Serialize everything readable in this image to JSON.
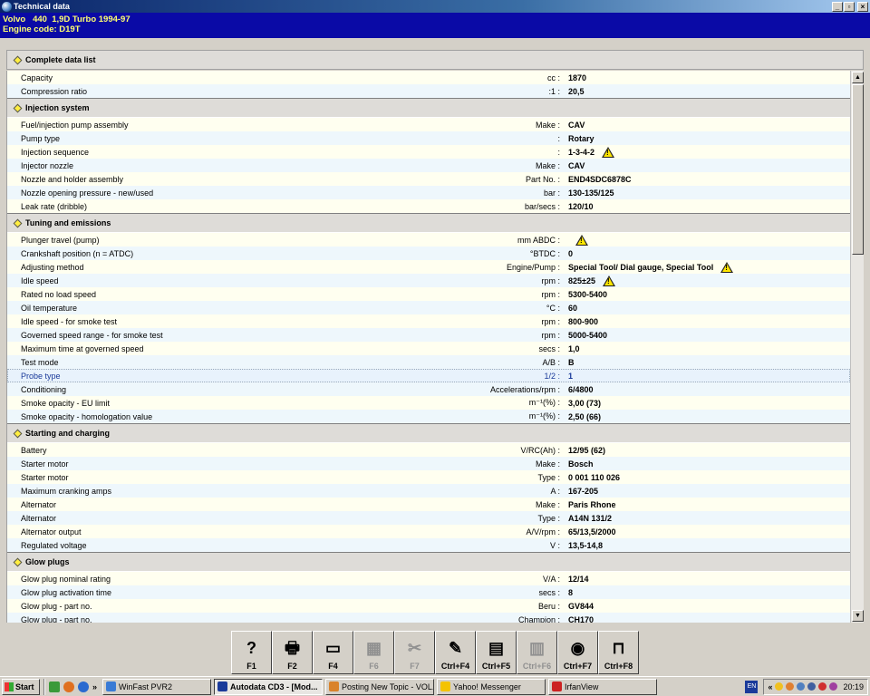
{
  "window": {
    "title": "Technical data",
    "buttons": [
      "_",
      "▫",
      "×"
    ]
  },
  "header": {
    "line1": "Volvo   440  1,9D Turbo 1994-97",
    "line2": "Engine code: D19T"
  },
  "main_title": "Complete data list",
  "general": [
    {
      "label": "Capacity",
      "unit": "cc :",
      "value": "1870",
      "warn": false
    },
    {
      "label": "Compression ratio",
      "unit": ":1 :",
      "value": "20,5",
      "warn": false
    }
  ],
  "sections": [
    {
      "title": "Injection system",
      "rows": [
        {
          "label": "Fuel/injection pump assembly",
          "unit": "Make :",
          "value": "CAV",
          "warn": false
        },
        {
          "label": "Pump type",
          "unit": ":",
          "value": "Rotary",
          "warn": false
        },
        {
          "label": "Injection sequence",
          "unit": ":",
          "value": "1-3-4-2",
          "warn": true
        },
        {
          "label": "Injector nozzle",
          "unit": "Make :",
          "value": "CAV",
          "warn": false
        },
        {
          "label": "Nozzle and holder assembly",
          "unit": "Part No. :",
          "value": "END4SDC6878C",
          "warn": false
        },
        {
          "label": "Nozzle opening pressure - new/used",
          "unit": "bar :",
          "value": "130-135/125",
          "warn": false
        },
        {
          "label": "Leak rate (dribble)",
          "unit": "bar/secs :",
          "value": "120/10",
          "warn": false
        }
      ]
    },
    {
      "title": "Tuning and emissions",
      "rows": [
        {
          "label": "Plunger travel (pump)",
          "unit": "mm ABDC :",
          "value": "",
          "warn": true
        },
        {
          "label": "Crankshaft position (n = ATDC)",
          "unit": "°BTDC :",
          "value": "0",
          "warn": false
        },
        {
          "label": "Adjusting method",
          "unit": "Engine/Pump :",
          "value": "Special Tool/ Dial gauge, Special Tool",
          "warn": true
        },
        {
          "label": "Idle speed",
          "unit": "rpm :",
          "value": "825±25",
          "warn": true
        },
        {
          "label": "Rated no load speed",
          "unit": "rpm :",
          "value": "5300-5400",
          "warn": false
        },
        {
          "label": "Oil temperature",
          "unit": "°C :",
          "value": "60",
          "warn": false
        },
        {
          "label": "Idle speed - for smoke test",
          "unit": "rpm :",
          "value": "800-900",
          "warn": false
        },
        {
          "label": "Governed speed range - for smoke test",
          "unit": "rpm :",
          "value": "5000-5400",
          "warn": false
        },
        {
          "label": "Maximum time at governed speed",
          "unit": "secs :",
          "value": "1,0",
          "warn": false
        },
        {
          "label": "Test mode",
          "unit": "A/B :",
          "value": "B",
          "warn": false
        },
        {
          "label": "Probe type",
          "unit": "1/2 :",
          "value": "1",
          "warn": false,
          "selected": true
        },
        {
          "label": "Conditioning",
          "unit": "Accelerations/rpm :",
          "value": "6/4800",
          "warn": false
        },
        {
          "label": "Smoke opacity - EU limit",
          "unit": "m⁻¹(%) :",
          "value": "3,00 (73)",
          "warn": false
        },
        {
          "label": "Smoke opacity - homologation value",
          "unit": "m⁻¹(%) :",
          "value": "2,50 (66)",
          "warn": false
        }
      ]
    },
    {
      "title": "Starting and charging",
      "rows": [
        {
          "label": "Battery",
          "unit": "V/RC(Ah) :",
          "value": "12/95 (62)",
          "warn": false
        },
        {
          "label": "Starter motor",
          "unit": "Make :",
          "value": "Bosch",
          "warn": false
        },
        {
          "label": "Starter motor",
          "unit": "Type :",
          "value": "0 001 110 026",
          "warn": false
        },
        {
          "label": "Maximum cranking amps",
          "unit": "A :",
          "value": "167-205",
          "warn": false
        },
        {
          "label": "Alternator",
          "unit": "Make :",
          "value": "Paris Rhone",
          "warn": false
        },
        {
          "label": "Alternator",
          "unit": "Type :",
          "value": "A14N 131/2",
          "warn": false
        },
        {
          "label": "Alternator output",
          "unit": "A/V/rpm :",
          "value": "65/13,5/2000",
          "warn": false
        },
        {
          "label": "Regulated voltage",
          "unit": "V :",
          "value": "13,5-14,8",
          "warn": false
        }
      ]
    },
    {
      "title": "Glow plugs",
      "rows": [
        {
          "label": "Glow plug nominal rating",
          "unit": "V/A :",
          "value": "12/14",
          "warn": false
        },
        {
          "label": "Glow plug activation time",
          "unit": "secs :",
          "value": "8",
          "warn": false
        },
        {
          "label": "Glow plug - part no.",
          "unit": "Beru :",
          "value": "GV844",
          "warn": false
        },
        {
          "label": "Glow plug - part no.",
          "unit": "Champion :",
          "value": "CH170",
          "warn": false
        }
      ]
    }
  ],
  "fkeys": [
    {
      "label": "F1",
      "icon": "help-icon",
      "glyph": "?",
      "enabled": true
    },
    {
      "label": "F2",
      "icon": "printer-icon",
      "glyph": "🖶",
      "enabled": true
    },
    {
      "label": "F4",
      "icon": "monitor-icon",
      "glyph": "▭",
      "enabled": true
    },
    {
      "label": "F6",
      "icon": "print-graph-icon",
      "glyph": "▦",
      "enabled": false
    },
    {
      "label": "F7",
      "icon": "tool-icon",
      "glyph": "✂",
      "enabled": false
    },
    {
      "label": "Ctrl+F4",
      "icon": "notes-icon",
      "glyph": "✎",
      "enabled": true
    },
    {
      "label": "Ctrl+F5",
      "icon": "chart-icon",
      "glyph": "▤",
      "enabled": true
    },
    {
      "label": "Ctrl+F6",
      "icon": "data-icon",
      "glyph": "▥",
      "enabled": false
    },
    {
      "label": "Ctrl+F7",
      "icon": "dial-icon",
      "glyph": "◉",
      "enabled": true
    },
    {
      "label": "Ctrl+F8",
      "icon": "lift-icon",
      "glyph": "⊓",
      "enabled": true
    }
  ],
  "taskbar": {
    "start": "Start",
    "tasks": [
      {
        "label": "WinFast PVR2",
        "color": "#3a7bd5",
        "active": false
      },
      {
        "label": "Autodata CD3 - [Mod...",
        "color": "#1a3a9a",
        "active": true
      },
      {
        "label": "Posting New Topic - VOL...",
        "color": "#d9822b",
        "active": false
      },
      {
        "label": "Yahoo! Messenger",
        "color": "#f4c300",
        "active": false
      },
      {
        "label": "IrfanView",
        "color": "#cc2222",
        "active": false
      }
    ],
    "lang": "EN",
    "clock": "20:19"
  },
  "colors": {
    "header_bg": "#0a0aa6",
    "header_text": "#ffff70",
    "row_alt": "#fffff0",
    "row_plain": "#eef7fc"
  }
}
